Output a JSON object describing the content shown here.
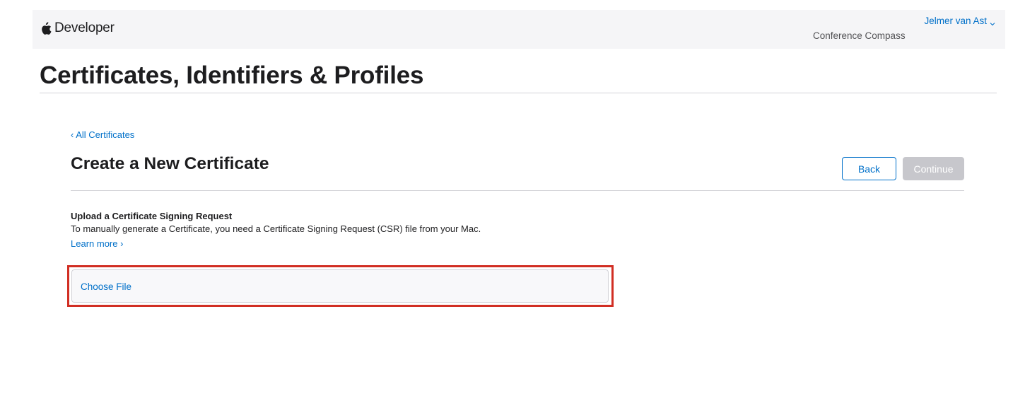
{
  "header": {
    "brand_label": "Developer",
    "brand_icon": "apple-logo-icon",
    "user_name": "Jelmer van Ast",
    "user_menu_icon": "chevron-down-icon",
    "team_name": "Conference Compass"
  },
  "page": {
    "title": "Certificates, Identifiers & Profiles"
  },
  "section": {
    "back_link": "‹ All Certificates",
    "title": "Create a New Certificate",
    "back_button": "Back",
    "continue_button": "Continue",
    "continue_enabled": false
  },
  "upload": {
    "heading": "Upload a Certificate Signing Request",
    "description": "To manually generate a Certificate, you need a Certificate Signing Request (CSR) file from your Mac.",
    "learn_more": "Learn more ›",
    "choose_file_label": "Choose File"
  },
  "annotation": {
    "highlight_color": "#d12e23"
  },
  "colors": {
    "accent": "#0070c9",
    "disabled_button": "#c7c7cc",
    "header_background": "#f5f5f7"
  }
}
